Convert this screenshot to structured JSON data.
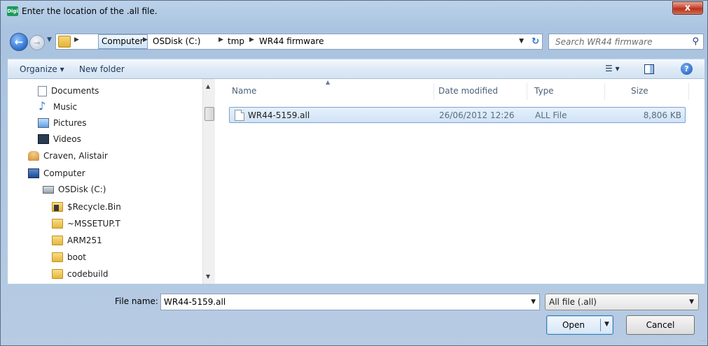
{
  "window": {
    "title": "Enter the location of the .all file.",
    "icon_text": "Digi",
    "close_label": "x"
  },
  "address": {
    "crumbs": [
      "Computer",
      "OSDisk (C:)",
      "tmp",
      "WR44 firmware"
    ],
    "search_placeholder": "Search WR44 firmware"
  },
  "toolbar": {
    "organize_label": "Organize ▾",
    "new_folder_label": "New folder"
  },
  "nav": {
    "items": [
      {
        "label": "Documents",
        "icon": "documents-icon"
      },
      {
        "label": "Music",
        "icon": "music-icon"
      },
      {
        "label": "Pictures",
        "icon": "pictures-icon"
      },
      {
        "label": "Videos",
        "icon": "videos-icon"
      },
      {
        "label": "Craven, Alistair",
        "icon": "user-folder-icon"
      },
      {
        "label": "Computer",
        "icon": "computer-icon"
      },
      {
        "label": "OSDisk (C:)",
        "icon": "disk-icon"
      },
      {
        "label": "$Recycle.Bin",
        "icon": "recycle-folder-icon"
      },
      {
        "label": "~MSSETUP.T",
        "icon": "folder-icon"
      },
      {
        "label": "ARM251",
        "icon": "folder-icon"
      },
      {
        "label": "boot",
        "icon": "folder-icon"
      },
      {
        "label": "codebuild",
        "icon": "folder-icon"
      }
    ]
  },
  "files": {
    "columns": [
      "Name",
      "Date modified",
      "Type",
      "Size"
    ],
    "rows": [
      {
        "name": "WR44-5159.all",
        "date": "26/06/2012 12:26",
        "type": "ALL File",
        "size": "8,806 KB",
        "selected": true
      }
    ]
  },
  "bottom": {
    "file_name_label": "File name:",
    "file_name_value": "WR44-5159.all",
    "filter_value": "All file (.all)",
    "open_label": "Open",
    "cancel_label": "Cancel"
  }
}
